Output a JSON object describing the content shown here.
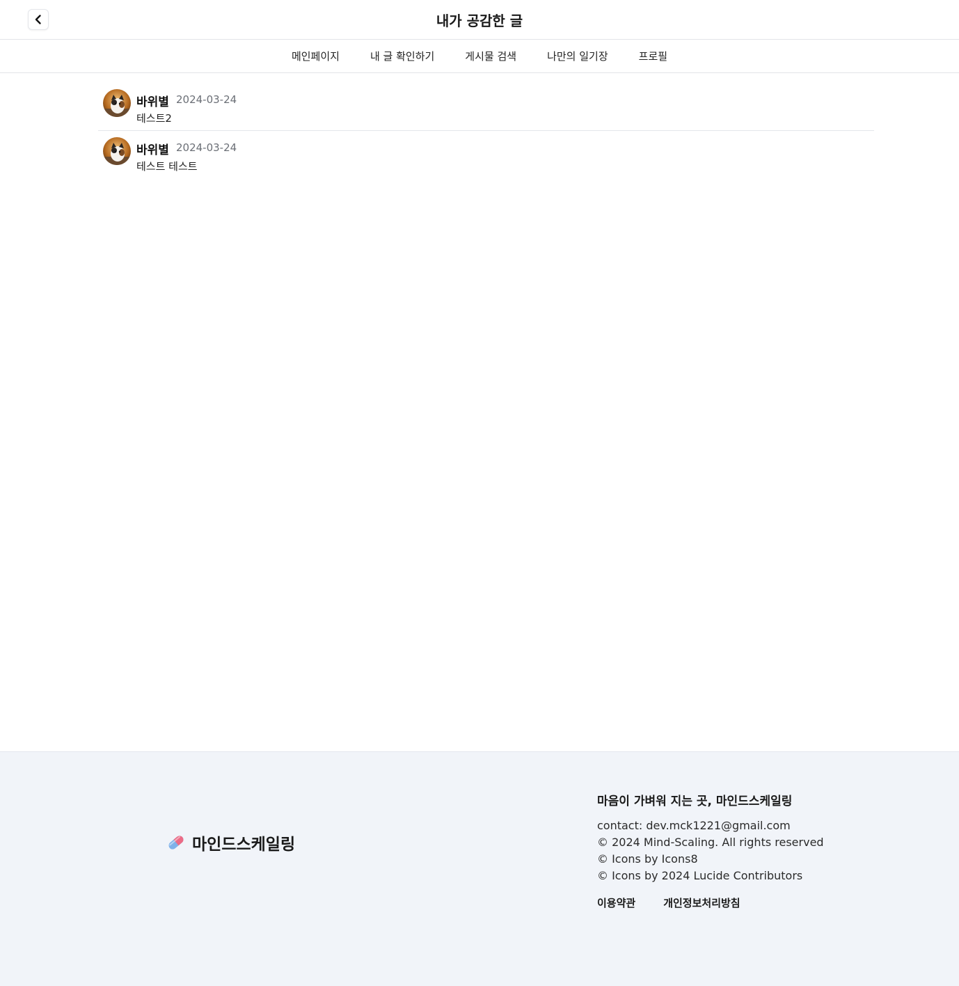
{
  "header": {
    "title": "내가 공감한 글",
    "back_icon": "chevron-left-icon"
  },
  "nav": {
    "items": [
      {
        "label": "메인페이지"
      },
      {
        "label": "내 글 확인하기"
      },
      {
        "label": "게시물 검색"
      },
      {
        "label": "나만의 일기장"
      },
      {
        "label": "프로필"
      }
    ]
  },
  "posts": [
    {
      "author": "바위별",
      "date": "2024-03-24",
      "content": "테스트2"
    },
    {
      "author": "바위별",
      "date": "2024-03-24",
      "content": "테스트 테스트"
    }
  ],
  "footer": {
    "brand_icon": "pill-icon",
    "brand_name": "마인드스케일링",
    "slogan": "마음이 가벼워 지는 곳, 마인드스케일링",
    "contact": "contact: dev.mck1221@gmail.com",
    "copyright": "© 2024 Mind-Scaling. All rights reserved",
    "icons_credit_1": "© Icons by Icons8",
    "icons_credit_2": "© Icons by 2024 Lucide Contributors",
    "links": [
      {
        "label": "이용약관"
      },
      {
        "label": "개인정보처리방침"
      }
    ]
  },
  "colors": {
    "footer_bg": "#f1f4f9",
    "divider": "#e2e4e8",
    "date_text": "#6b6f76"
  }
}
